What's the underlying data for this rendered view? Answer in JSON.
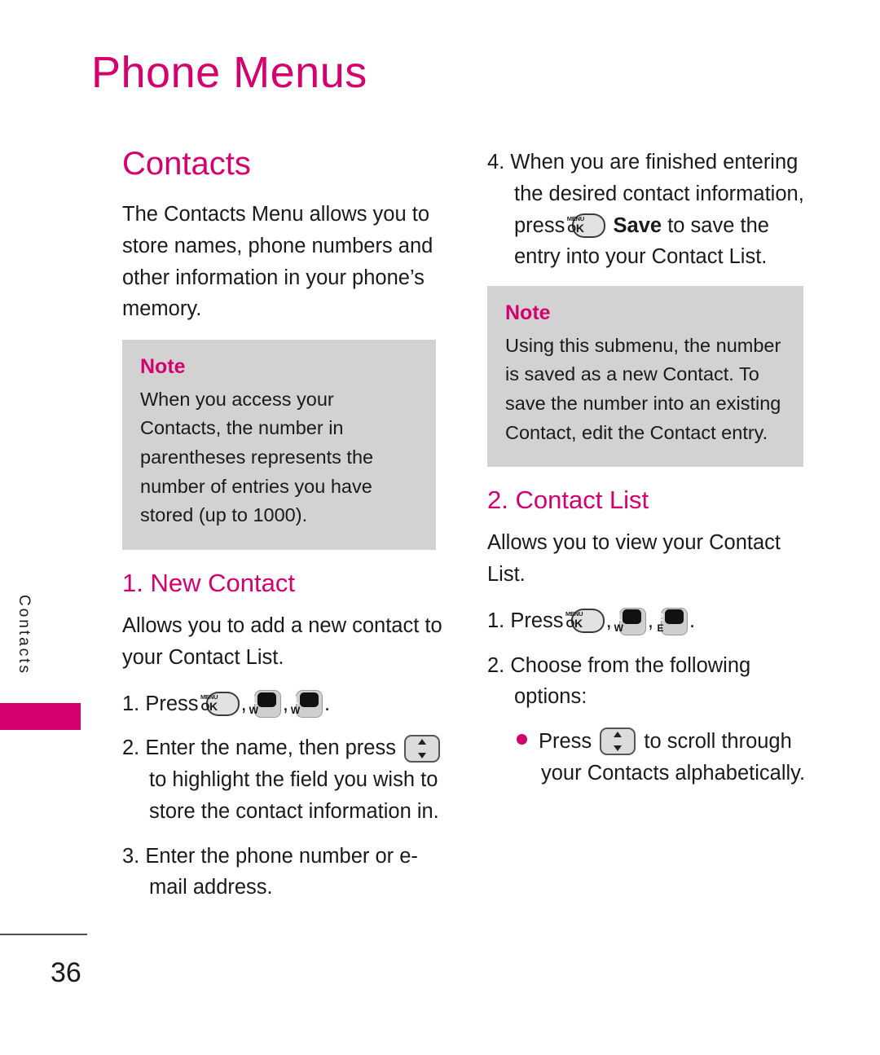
{
  "page": {
    "title": "Phone Menus",
    "number": "36",
    "side_tab_label": "Contacts",
    "accent_color": "#d4006e",
    "note_bg_color": "#d2d2d2"
  },
  "left_column": {
    "section_heading": "Contacts",
    "intro_paragraph": "The Contacts Menu allows you to store names, phone numbers and other information in your phone’s memory.",
    "note": {
      "title": "Note",
      "body": "When you access your Contacts, the number in parentheses represents the number of entries you have stored (up to 1000)."
    },
    "sub_heading": "1. New Contact",
    "sub_paragraph": "Allows you to add a new contact to your Contact List.",
    "steps": {
      "step1_num": "1.",
      "step1_press": "Press",
      "step1_comma1": ",",
      "step1_comma2": ",",
      "step1_period": ".",
      "step2_num": "2.",
      "step2_text_a": "Enter the name, then press",
      "step2_text_b": "to highlight the field you wish to store the contact information in.",
      "step3_num": "3.",
      "step3_text": "Enter the phone number or e-mail address."
    },
    "keys": {
      "menuok_top": "MENU",
      "menuok_bottom": "OK",
      "key1_digit": "1",
      "key1_letter": "W",
      "key2_digit": "1",
      "key2_letter": "W"
    }
  },
  "right_column": {
    "step4": {
      "num": "4.",
      "text_a": "When you are finished entering the desired contact information, press",
      "save_label": "Save",
      "text_b": "to save the entry into your Contact List."
    },
    "note": {
      "title": "Note",
      "body": "Using this submenu, the number is saved as a new Contact. To save the number into an existing Contact, edit the Contact entry."
    },
    "sub_heading": "2. Contact List",
    "sub_paragraph": "Allows you to view your Contact List.",
    "steps": {
      "step1_num": "1.",
      "step1_press": "Press",
      "step1_comma1": ",",
      "step1_comma2": ",",
      "step1_period": ".",
      "step2_num": "2.",
      "step2_text": "Choose from the following options:",
      "bullet1_a": "Press",
      "bullet1_b": "to scroll through your Contacts alphabetically."
    },
    "keys": {
      "menuok_top": "MENU",
      "menuok_bottom": "OK",
      "save_menuok_top": "MENU",
      "save_menuok_bottom": "OK",
      "key1_digit": "1",
      "key1_letter": "W",
      "key2_digit": "2",
      "key2_letter": "E"
    }
  }
}
